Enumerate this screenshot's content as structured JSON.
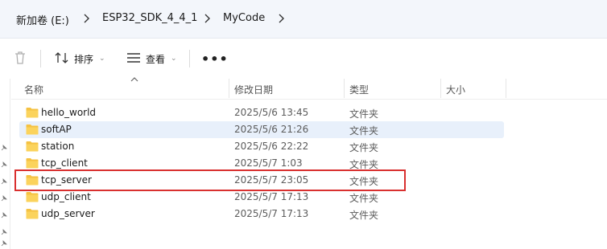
{
  "breadcrumb": {
    "items": [
      {
        "label": "新加卷 (E:)"
      },
      {
        "label": "ESP32_SDK_4_4_1"
      },
      {
        "label": "MyCode"
      }
    ]
  },
  "toolbar": {
    "delete_icon": "trash-icon",
    "sort_label": "排序",
    "view_label": "查看",
    "more_label": "•••"
  },
  "columns": {
    "name": "名称",
    "date": "修改日期",
    "type": "类型",
    "size": "大小"
  },
  "files": [
    {
      "name": "hello_world",
      "date": "2025/5/6 13:45",
      "type": "文件夹",
      "selected": false
    },
    {
      "name": "softAP",
      "date": "2025/5/6 21:26",
      "type": "文件夹",
      "selected": true
    },
    {
      "name": "station",
      "date": "2025/5/6 22:22",
      "type": "文件夹",
      "selected": false
    },
    {
      "name": "tcp_client",
      "date": "2025/5/7 1:03",
      "type": "文件夹",
      "selected": false
    },
    {
      "name": "tcp_server",
      "date": "2025/5/7 23:05",
      "type": "文件夹",
      "selected": false,
      "highlighted": true
    },
    {
      "name": "udp_client",
      "date": "2025/5/7 17:13",
      "type": "文件夹",
      "selected": false
    },
    {
      "name": "udp_server",
      "date": "2025/5/7 17:13",
      "type": "文件夹",
      "selected": false
    }
  ],
  "colors": {
    "highlight_border": "#d9302f",
    "selection_bg": "#e8f0fb",
    "folder": "#f5c242"
  }
}
